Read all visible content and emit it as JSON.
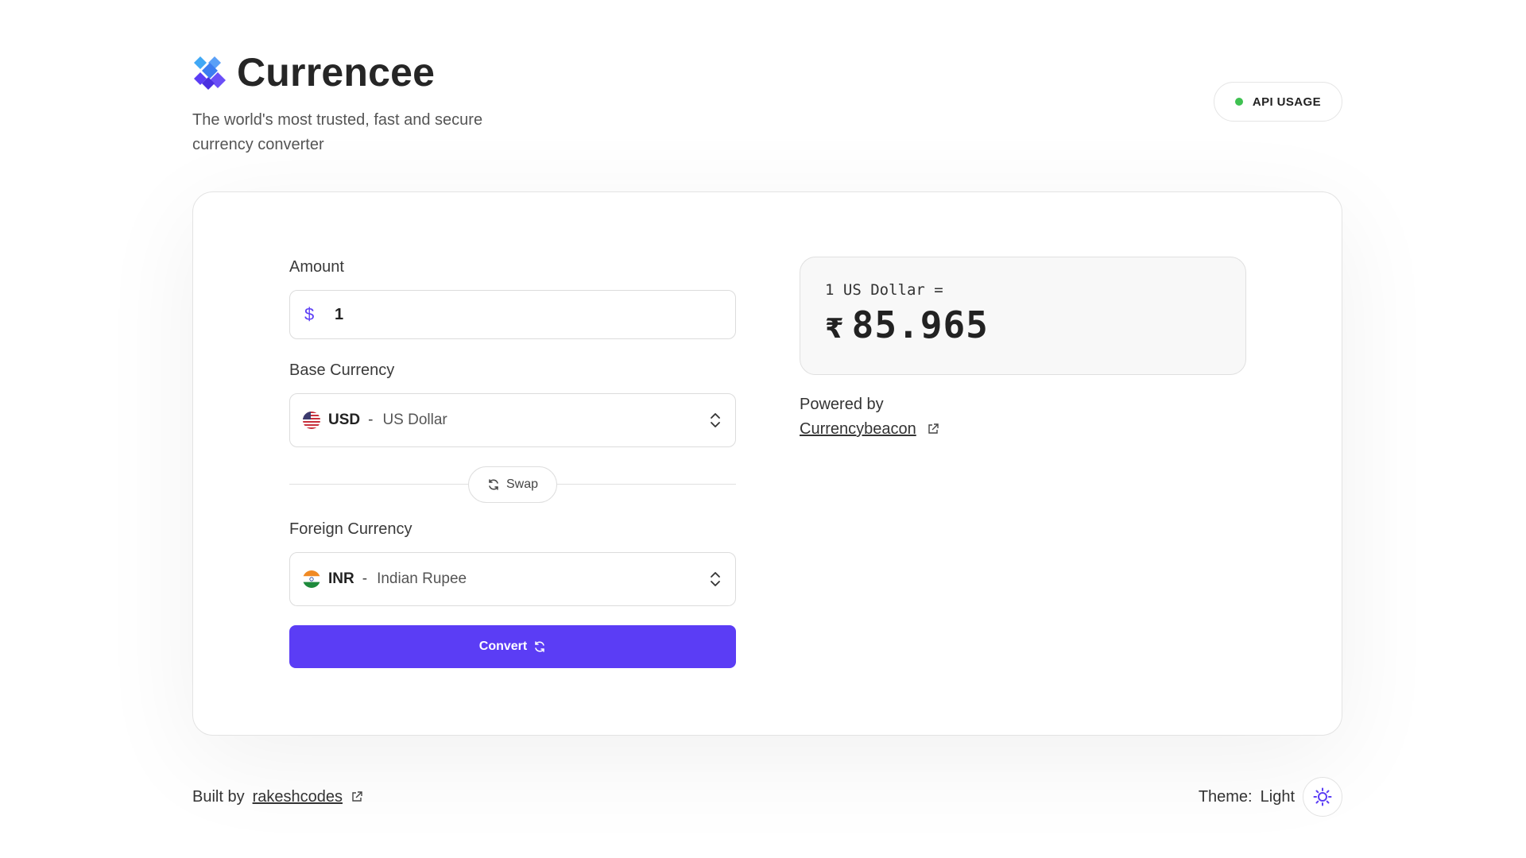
{
  "app": {
    "brand": "Currencee",
    "tagline": "The world's most trusted, fast and secure currency converter",
    "api_usage_label": "API USAGE",
    "accent_color": "#5b3df5",
    "status_dot_color": "#3fc151"
  },
  "form": {
    "amount_label": "Amount",
    "amount_symbol": "$",
    "amount_value": "1",
    "base_label": "Base Currency",
    "base_code": "USD",
    "base_dash": "-",
    "base_name": "US Dollar",
    "base_flag_icon": "us-flag-icon",
    "swap_label": "Swap",
    "foreign_label": "Foreign Currency",
    "foreign_code": "INR",
    "foreign_dash": "-",
    "foreign_name": "Indian Rupee",
    "foreign_flag_icon": "india-flag-icon",
    "convert_label": "Convert"
  },
  "result": {
    "rate_line": "1 US Dollar =",
    "currency_symbol": "₹",
    "value": "85.965",
    "powered_by": "Powered by",
    "provider": "Currencybeacon"
  },
  "footer": {
    "built_by": "Built by",
    "author": "rakeshcodes",
    "theme_label": "Theme:",
    "theme_value": "Light"
  }
}
